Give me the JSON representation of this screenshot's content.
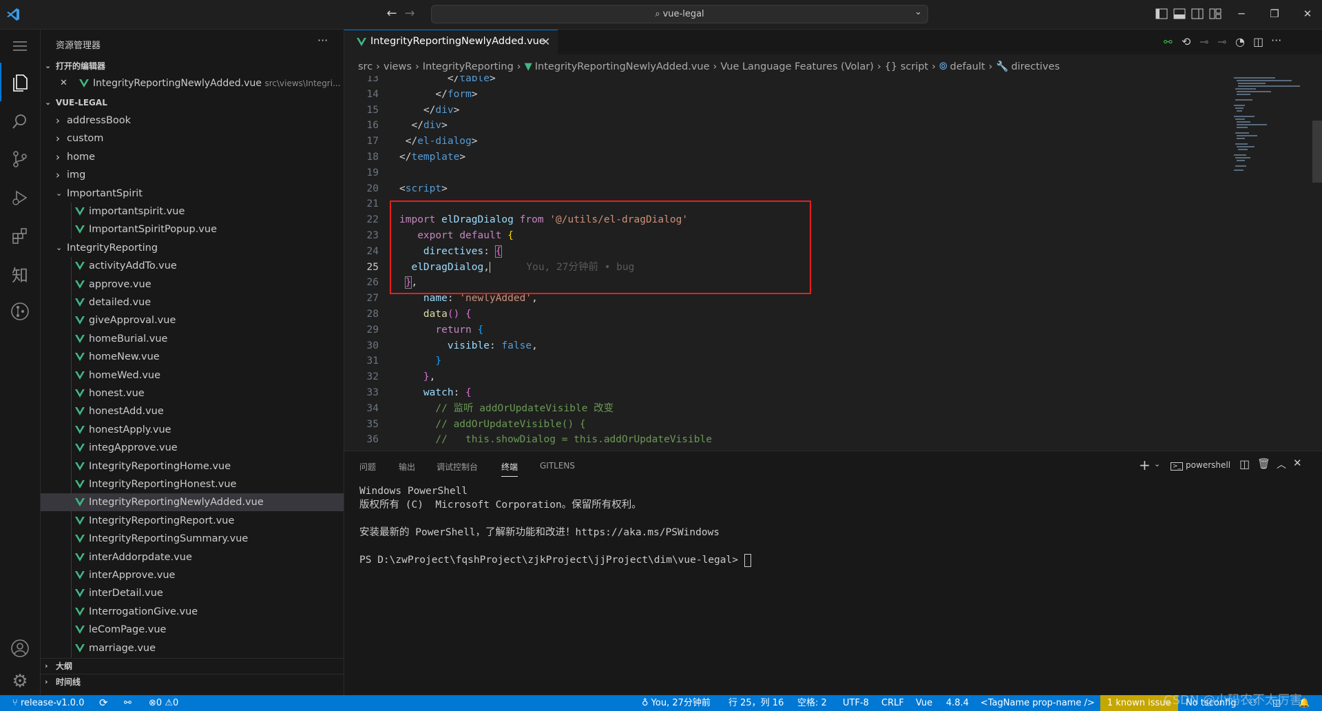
{
  "titlebar": {
    "search_text": "vue-legal",
    "back_label": "←",
    "forward_label": "→"
  },
  "sidebar": {
    "title": "资源管理器",
    "more": "···",
    "open_editors": {
      "header": "打开的编辑器",
      "file": "IntegrityReportingNewlyAdded.vue",
      "path": "src\\views\\Integri..."
    },
    "project": {
      "header": "VUE-LEGAL",
      "folders": [
        "addressBook",
        "custom",
        "home",
        "img"
      ],
      "important_folder": "ImportantSpirit",
      "important_files": [
        "importantspirit.vue",
        "ImportantSpiritPopup.vue"
      ],
      "integrity_folder": "IntegrityReporting",
      "integrity_files": [
        "activityAddTo.vue",
        "approve.vue",
        "detailed.vue",
        "giveApproval.vue",
        "homeBurial.vue",
        "homeNew.vue",
        "homeWed.vue",
        "honest.vue",
        "honestAdd.vue",
        "honestApply.vue",
        "integApprove.vue",
        "IntegrityReportingHome.vue",
        "IntegrityReportingHonest.vue",
        "IntegrityReportingNewlyAdded.vue",
        "IntegrityReportingReport.vue",
        "IntegrityReportingSummary.vue",
        "interAddorpdate.vue",
        "interApprove.vue",
        "interDetail.vue",
        "InterrogationGive.vue",
        "leComPage.vue",
        "marriage.vue"
      ]
    },
    "outline": "大纲",
    "timeline": "时间线"
  },
  "editor": {
    "tab_label": "IntegrityReportingNewlyAdded.vue",
    "tab_close": "✕",
    "breadcrumb": [
      "src",
      "views",
      "IntegrityReporting",
      "IntegrityReportingNewlyAdded.vue",
      "Vue Language Features (Volar)",
      "{} script",
      "default",
      "directives"
    ],
    "lines": [
      "13",
      "14",
      "15",
      "16",
      "17",
      "18",
      "19",
      "20",
      "21",
      "22",
      "23",
      "24",
      "25",
      "26",
      "27",
      "28",
      "29",
      "30",
      "31",
      "32",
      "33",
      "34",
      "35",
      "36"
    ],
    "blame": "You, 27分钟前 • bug"
  },
  "panel": {
    "tabs": [
      "问题",
      "输出",
      "调试控制台",
      "终端",
      "GITLENS"
    ],
    "terminal_name": "powershell",
    "terminal_lines": [
      "Windows PowerShell",
      "版权所有 (C)  Microsoft Corporation。保留所有权利。",
      "",
      "安装最新的 PowerShell，了解新功能和改进！https://aka.ms/PSWindows",
      "",
      "PS D:\\zwProject\\fqshProject\\zjkProject\\jjProject\\dim\\vue-legal> "
    ]
  },
  "statusbar": {
    "branch": "release-v1.0.0",
    "errors": "0",
    "warnings": "0",
    "blame": "You, 27分钟前",
    "position": "行 25，列 16",
    "spaces": "空格: 2",
    "encoding": "UTF-8",
    "eol": "CRLF",
    "language": "Vue",
    "version": "4.8.4",
    "tagname": "<TagName prop-name />",
    "issue": "1 known issue",
    "tsconfig": "No tsconfig"
  },
  "watermark": "CSDN @小码农不太厉害"
}
